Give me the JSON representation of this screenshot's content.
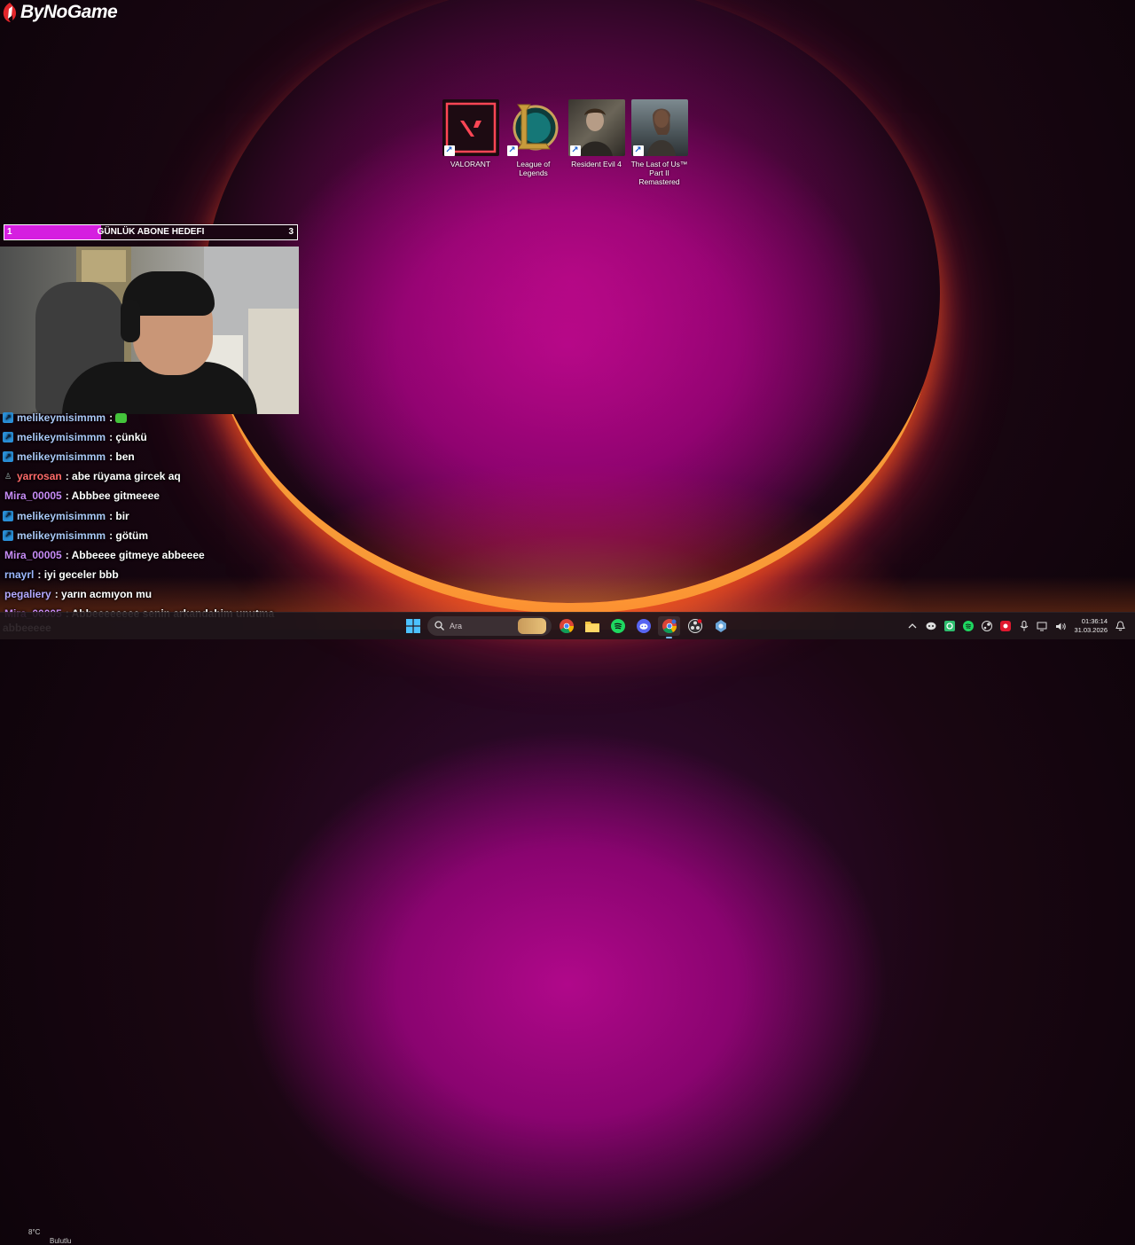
{
  "brand": {
    "logo_text": "ByNoGame"
  },
  "desktop_icons": [
    {
      "name": "valorant",
      "label": "VALORANT"
    },
    {
      "name": "league-of-legends",
      "label": "League of Legends"
    },
    {
      "name": "resident-evil-4",
      "label": "Resident Evil 4"
    },
    {
      "name": "last-of-us-2",
      "label": "The Last of Us™ Part II Remastered"
    }
  ],
  "goal": {
    "title": "GÜNLÜK ABONE HEDEFI",
    "current": "1",
    "max": "3",
    "progress": 0.33
  },
  "chat": [
    {
      "badge": "sub",
      "user": "melikeymisimmm",
      "user_color": "#a9c7f5",
      "message": ":",
      "emote": true
    },
    {
      "badge": "sub",
      "user": "melikeymisimmm",
      "user_color": "#a9c7f5",
      "message": ": çünkü"
    },
    {
      "badge": "sub",
      "user": "melikeymisimmm",
      "user_color": "#a9c7f5",
      "message": ": ben"
    },
    {
      "badge": "mod",
      "user": "yarrosan",
      "user_color": "#ff6a6a",
      "message": ": abe rüyama gircek aq"
    },
    {
      "badge": "",
      "user": "Mira_00005",
      "user_color": "#c78bf5",
      "message": ": Abbbee gitmeeee"
    },
    {
      "badge": "sub",
      "user": "melikeymisimmm",
      "user_color": "#a9c7f5",
      "message": ": bir"
    },
    {
      "badge": "sub",
      "user": "melikeymisimmm",
      "user_color": "#a9c7f5",
      "message": ": götüm"
    },
    {
      "badge": "",
      "user": "Mira_00005",
      "user_color": "#c78bf5",
      "message": ": Abbeeee gitmeye abbeeee"
    },
    {
      "badge": "",
      "user": "rnayrl",
      "user_color": "#9db8ff",
      "message": ": iyi geceler bbb"
    },
    {
      "badge": "",
      "user": "pegaliery",
      "user_color": "#b4a9ff",
      "message": ": yarın acmıyon mu"
    },
    {
      "badge": "",
      "user": "Mira_00005",
      "user_color": "#c78bf5",
      "message": ": Abbeeeeeeee senin arkandahim unutma"
    }
  ],
  "chat_overflow": "abbeeeee",
  "weather": {
    "temp": "8°C",
    "desc": "Bulutlu"
  },
  "taskbar": {
    "search_placeholder": "Ara",
    "apps": [
      "start-icon",
      "search-bar",
      "chrome-icon",
      "file-explorer-icon",
      "spotify-icon",
      "discord-icon",
      "chrome-profile-icon",
      "obs-icon",
      "settings-app-icon"
    ]
  },
  "tray": {
    "time": "01:36:14",
    "date": "31.03.2026"
  },
  "colors": {
    "goal_fill": "#d51fe0",
    "accent": "#7ab8ff"
  }
}
